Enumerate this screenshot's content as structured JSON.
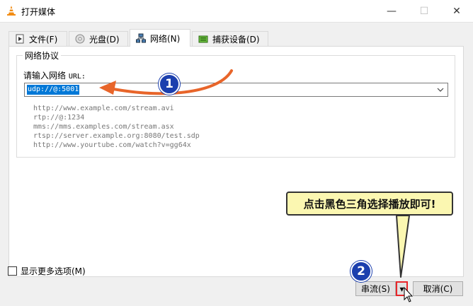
{
  "window": {
    "title": "打开媒体",
    "minimize_glyph": "—",
    "maximize_glyph": "☐",
    "close_glyph": "✕"
  },
  "tabs": [
    {
      "label": "文件(F)",
      "icon": "file-icon"
    },
    {
      "label": "光盘(D)",
      "icon": "disc-icon"
    },
    {
      "label": "网络(N)",
      "icon": "network-icon",
      "active": true
    },
    {
      "label": "捕获设备(D)",
      "icon": "capture-icon"
    }
  ],
  "network": {
    "group_title": "网络协议",
    "url_label": "请输入网络",
    "url_label_suffix": "URL:",
    "url_value": "udp://@:5001",
    "examples": [
      "http://www.example.com/stream.avi",
      "rtp://@:1234",
      "mms://mms.examples.com/stream.asx",
      "rtsp://server.example.org:8080/test.sdp",
      "http://www.yourtube.com/watch?v=gg64x"
    ]
  },
  "options": {
    "show_more_label": "显示更多选项(M)"
  },
  "buttons": {
    "stream_label": "串流(S)",
    "dropdown_glyph": "▾",
    "cancel_label": "取消(C)"
  },
  "annotations": {
    "badge1": "1",
    "badge2": "2",
    "callout": "点击黑色三角选择播放即可!",
    "accent_arrow": "#e8652a",
    "highlight_border": "#e8262a",
    "badge_color": "#1b3fae",
    "callout_bg": "#fbf7b1"
  }
}
